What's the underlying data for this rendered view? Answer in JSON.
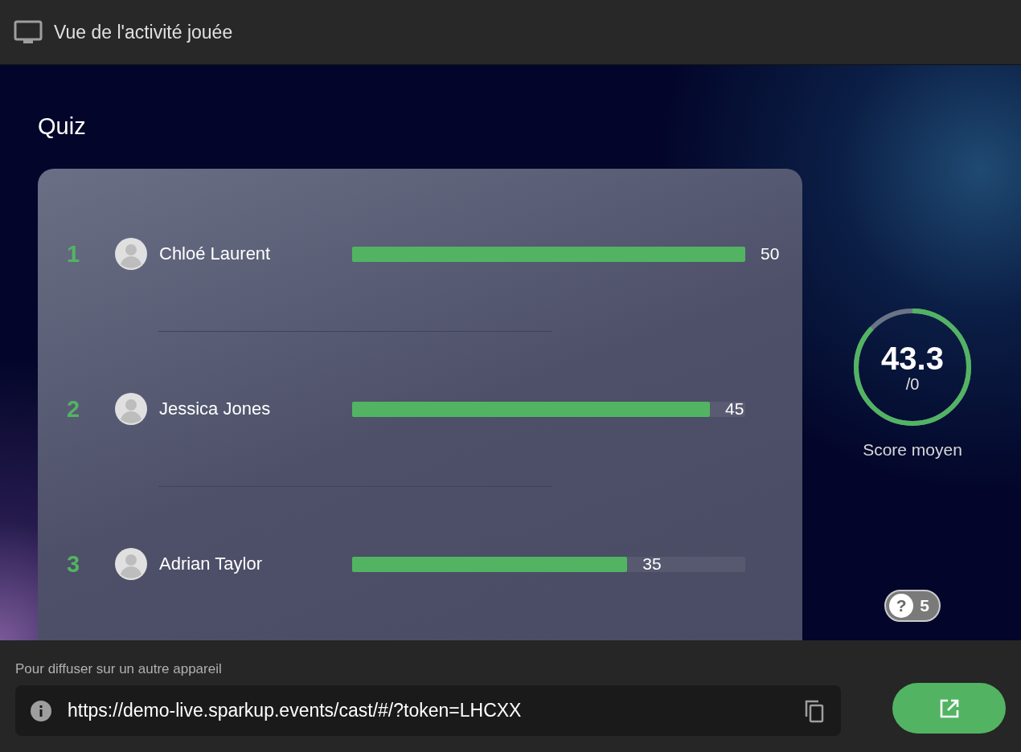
{
  "header": {
    "title": "Vue de l'activité jouée"
  },
  "activity": {
    "title": "Quiz"
  },
  "ranking": [
    {
      "rank": "1",
      "name": "Chloé Laurent",
      "level": 1.0,
      "score": "50"
    },
    {
      "rank": "2",
      "name": "Jessica Jones",
      "level": 0.91,
      "score": "45"
    },
    {
      "rank": "3",
      "name": "Adrian Taylor",
      "level": 0.7,
      "score": "35"
    }
  ],
  "average": {
    "value": "43.3",
    "max": "/0",
    "level": 0.87,
    "label": "Score moyen"
  },
  "questions_badge": {
    "icon": "?",
    "count": "5"
  },
  "cast": {
    "label": "Pour diffuser sur un autre appareil",
    "url": "https://demo-live.sparkup.events/cast/#/?token=LHCXX"
  }
}
